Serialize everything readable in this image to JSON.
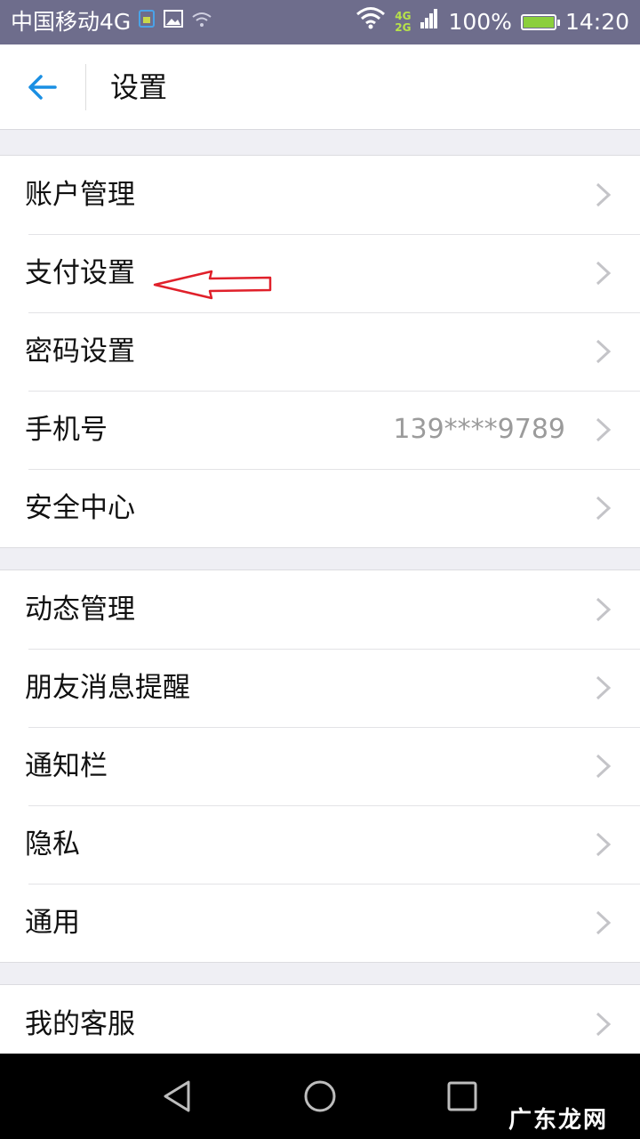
{
  "status_bar": {
    "carrier": "中国移动4G",
    "net_4g": "4G",
    "net_2g": "2G",
    "battery": "100%",
    "time": "14:20"
  },
  "header": {
    "title": "设置",
    "back_icon": "arrow-left-icon"
  },
  "groups": [
    {
      "items": [
        {
          "label": "账户管理",
          "value": ""
        },
        {
          "label": "支付设置",
          "value": ""
        },
        {
          "label": "密码设置",
          "value": ""
        },
        {
          "label": "手机号",
          "value": "139****9789"
        },
        {
          "label": "安全中心",
          "value": ""
        }
      ]
    },
    {
      "items": [
        {
          "label": "动态管理",
          "value": ""
        },
        {
          "label": "朋友消息提醒",
          "value": ""
        },
        {
          "label": "通知栏",
          "value": ""
        },
        {
          "label": "隐私",
          "value": ""
        },
        {
          "label": "通用",
          "value": ""
        }
      ]
    },
    {
      "items": [
        {
          "label": "我的客服",
          "value": ""
        }
      ]
    }
  ],
  "colors": {
    "accent": "#1a8fe3",
    "status_bar_bg": "#6e6d8c",
    "annotation": "#e0202a"
  },
  "watermark": "广东龙网"
}
